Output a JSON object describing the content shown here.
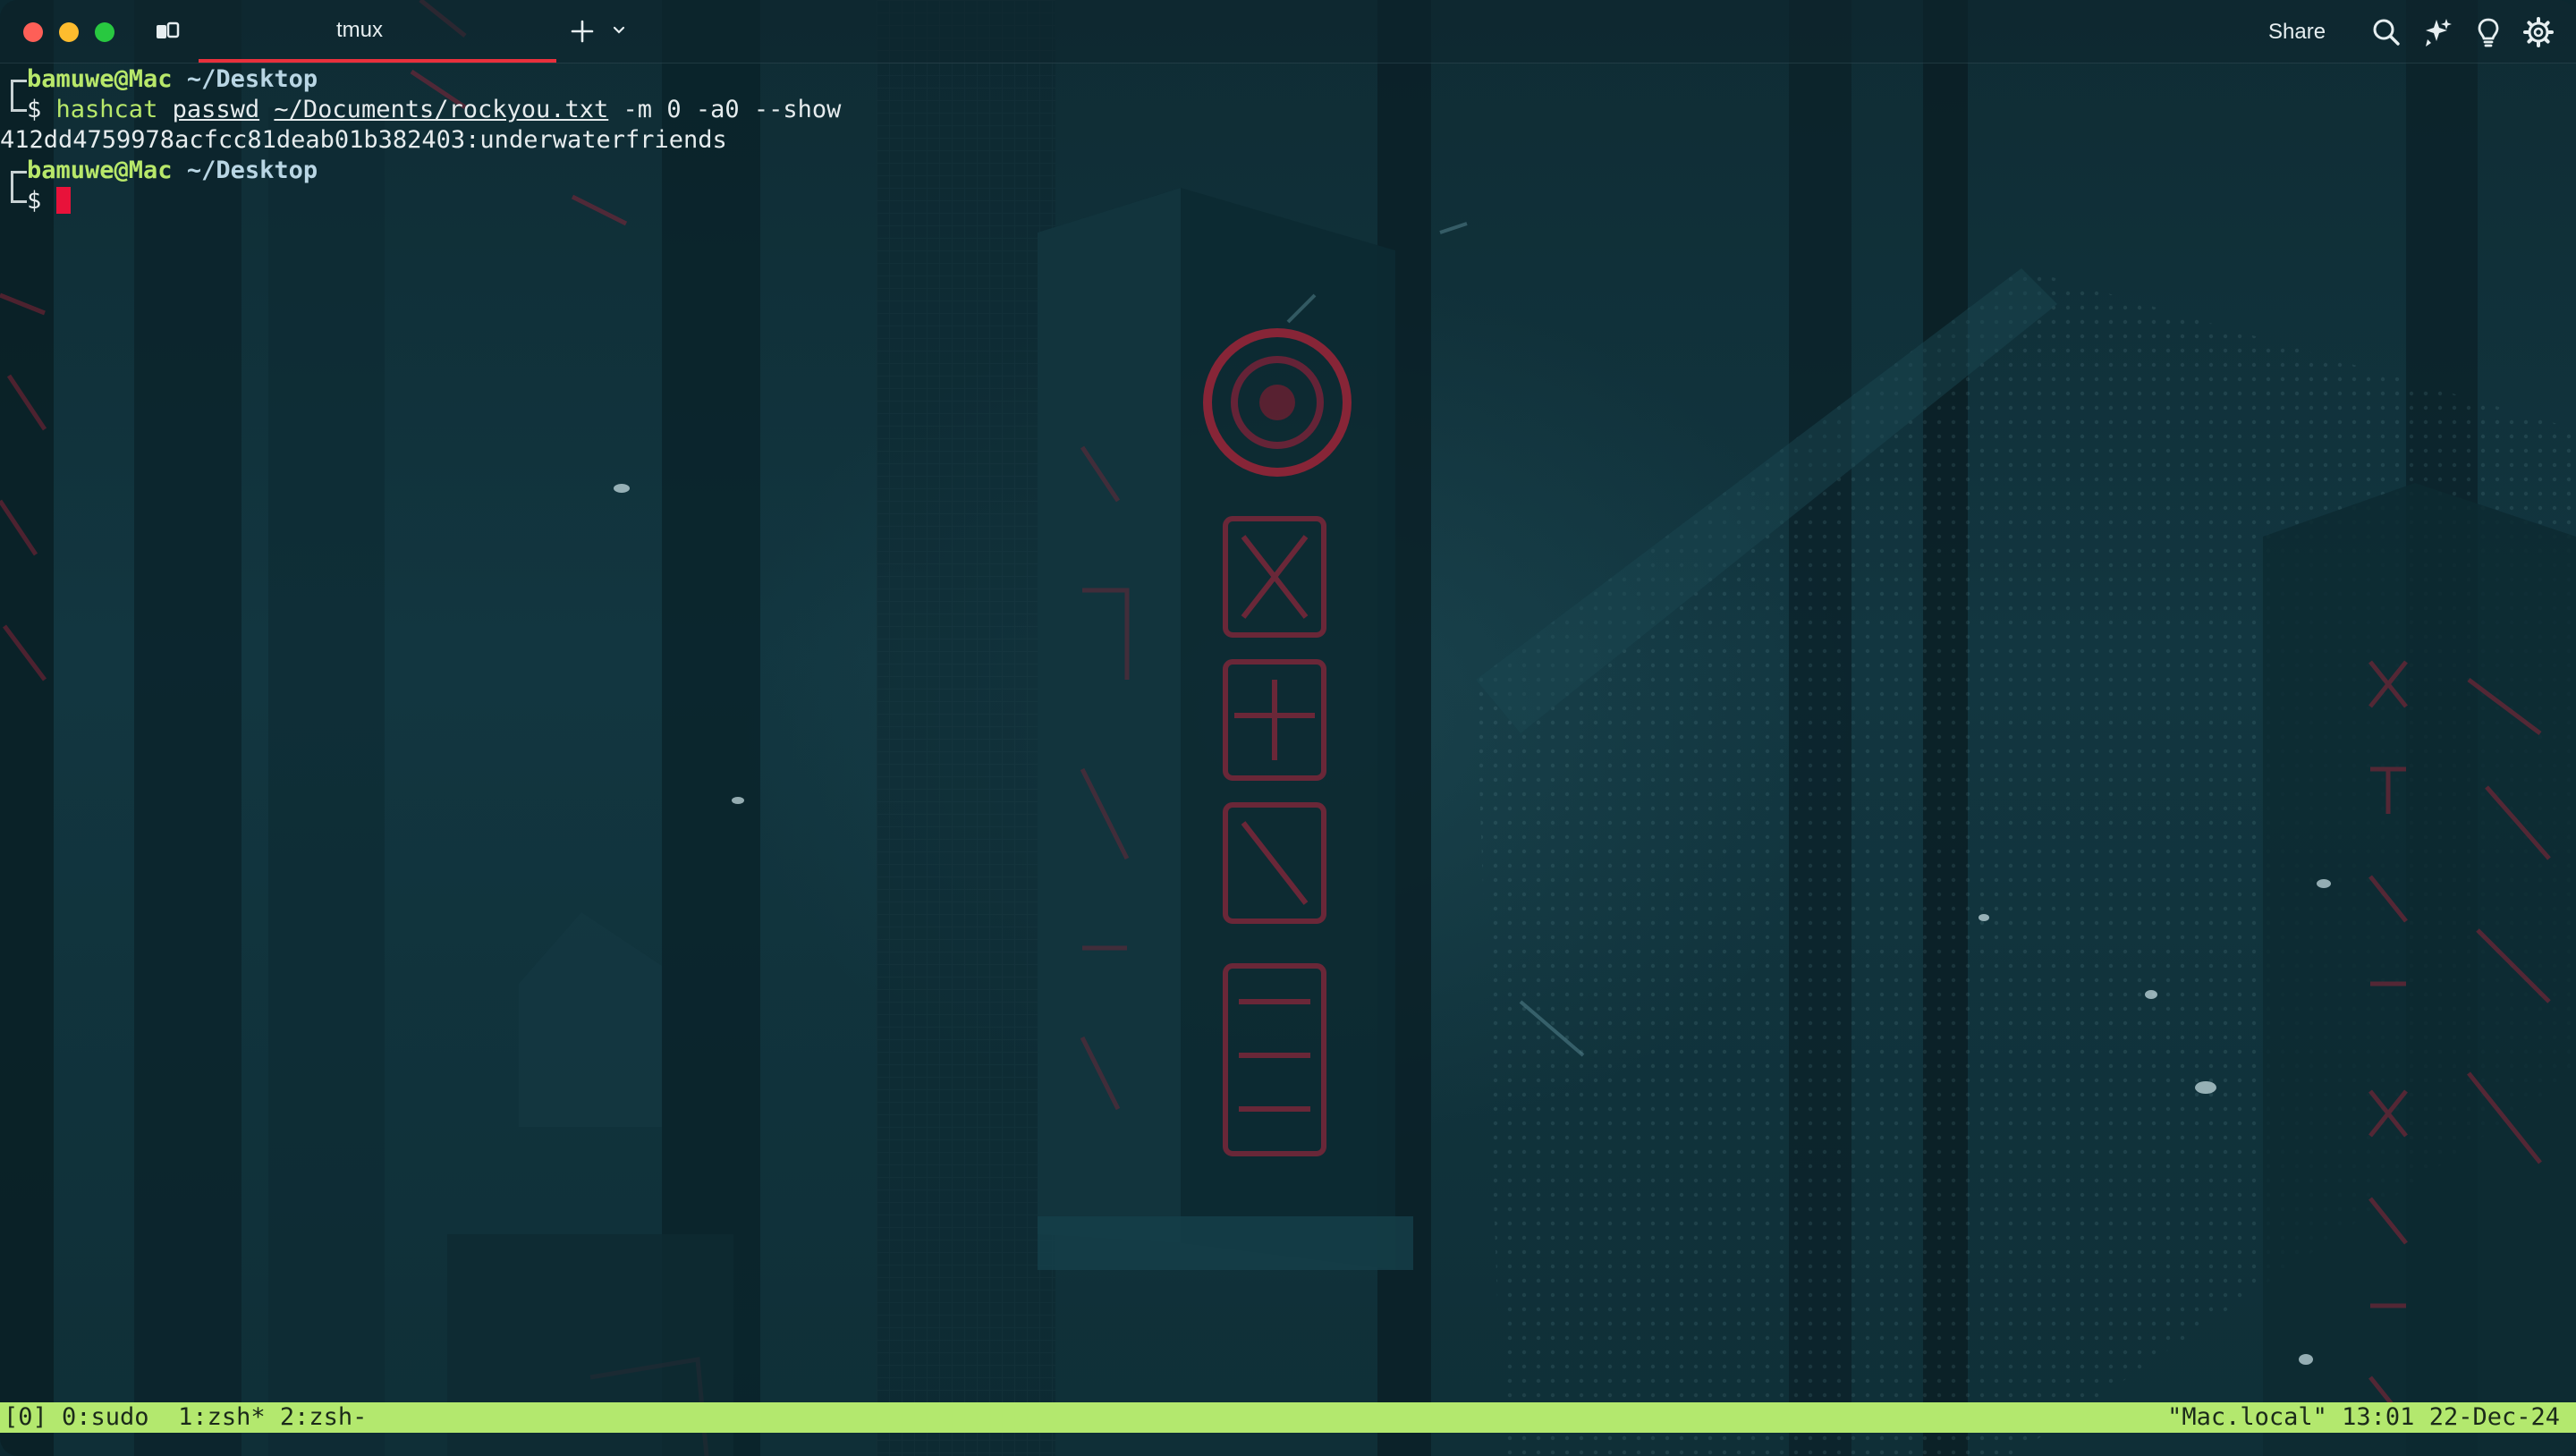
{
  "window": {
    "tab_label": "tmux",
    "share_label": "Share"
  },
  "toolbar_icons": {
    "sidebar": "sidebar-icon",
    "new_tab": "plus-icon",
    "dropdown": "chevron-down-icon",
    "search": "search-icon",
    "ai": "sparkles-icon",
    "hint": "lightbulb-icon",
    "settings": "gear-icon"
  },
  "terminal": {
    "prompt1": {
      "user": "bamuwe@Mac",
      "cwd": "~/Desktop",
      "symbol": "$",
      "command": "hashcat",
      "arg1": "passwd",
      "arg2": "~/Documents/rockyou.txt",
      "options": "-m 0 -a0 --show"
    },
    "output": "412dd4759978acfcc81deab01b382403:underwaterfriends",
    "prompt2": {
      "user": "bamuwe@Mac",
      "cwd": "~/Desktop",
      "symbol": "$"
    }
  },
  "tmux_status": {
    "left": "[0] 0:sudo  1:zsh* 2:zsh-",
    "right": "\"Mac.local\" 13:01 22-Dec-24"
  },
  "colors": {
    "accent_red": "#e8303c",
    "prompt_green": "#b8e86a",
    "status_bar": "#b3e86e",
    "cursor": "#e8123a"
  }
}
